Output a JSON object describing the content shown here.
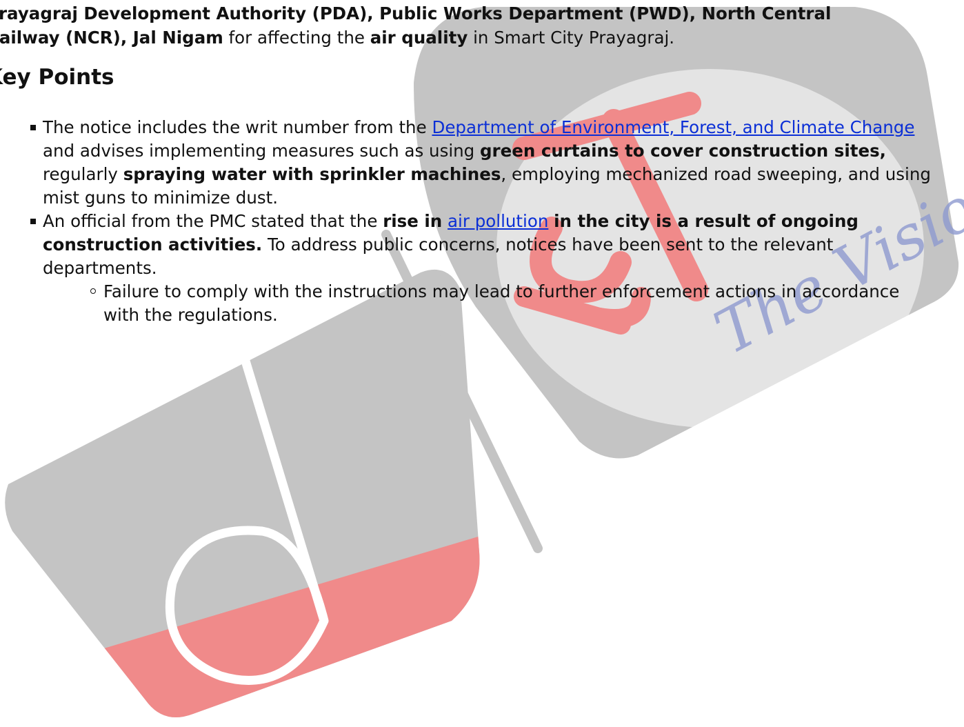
{
  "intro": {
    "line1_bold": "Prayagraj Development Authority (PDA), Public Works Department (PWD), North Central",
    "line2_bold": "Railway (NCR), Jal Nigam",
    "line2_mid": " for affecting the ",
    "line2_bold2": "air quality",
    "line2_end": " in Smart City Prayagraj."
  },
  "heading": "Key Points",
  "points": [
    {
      "t1": "The notice includes the writ number from the ",
      "link1": "Department of Environment, Forest, and Climate Change",
      "t2": " and advises implementing measures such as using ",
      "b1": "green curtains to cover construction sites,",
      "t3": " regularly ",
      "b2": "spraying water with sprinkler machines",
      "t4": ", employing mechanized road sweeping, and using mist guns to minimize dust."
    },
    {
      "t1": "An official from the PMC stated that the ",
      "b1": "rise in",
      "t2": " ",
      "link1": "air pollution",
      "t3": " ",
      "b2": "in the city is a result of ongoing construction activities.",
      "t4": " To address public concerns, notices have been sent to the relevant departments.",
      "sub": [
        "Failure to comply with the instructions may lead to further enforcement actions in accordance with the regulations."
      ]
    }
  ],
  "watermark": {
    "text": "The Vision",
    "colors": {
      "grey": "#c4c4c4",
      "red": "#f08a8a",
      "blue": "#8e9ad0"
    }
  }
}
